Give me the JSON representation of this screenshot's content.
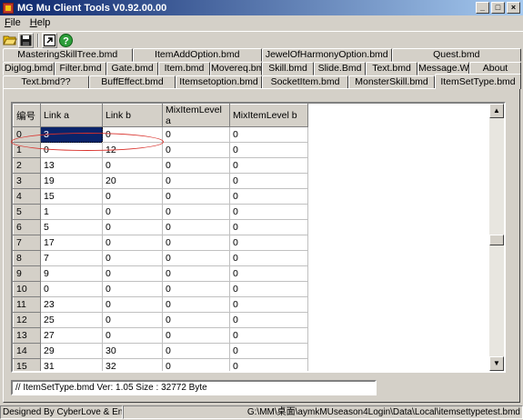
{
  "window": {
    "title": "MG Mu Client Tools  V0.92.00.00",
    "minimize": "_",
    "maximize": "□",
    "close": "×"
  },
  "menu": [
    {
      "underline": "F",
      "rest": "ile"
    },
    {
      "underline": "H",
      "rest": "elp"
    }
  ],
  "toolbar": {
    "icons": [
      "open-folder-icon",
      "save-icon",
      "export-icon",
      "help-icon"
    ]
  },
  "tabs": {
    "row1": [
      "MasteringSkillTree.bmd",
      "ItemAddOption.bmd",
      "JewelOfHarmonyOption.bmd",
      "Quest.bmd"
    ],
    "row2": [
      "Diglog.bmd",
      "Filter.bmd",
      "Gate.bmd",
      "Item.bmd",
      "Movereq.bmd",
      "Skill.bmd",
      "Slide.Bmd",
      "Text.bmd",
      "Message.Wtf",
      "About"
    ],
    "row3": [
      "Text.bmd??",
      "BuffEffect.bmd",
      "Itemsetoption.bmd",
      "SocketItem.bmd",
      "MonsterSkill.bmd",
      "ItemSetType.bmd"
    ],
    "active": "ItemSetType.bmd"
  },
  "grid": {
    "columns": [
      "编号",
      "Link a",
      "Link b",
      "MixItemLevel a",
      "MixItemLevel b"
    ],
    "rows": [
      [
        "0",
        "3",
        "0",
        "0",
        "0"
      ],
      [
        "1",
        "0",
        "12",
        "0",
        "0"
      ],
      [
        "2",
        "13",
        "0",
        "0",
        "0"
      ],
      [
        "3",
        "19",
        "20",
        "0",
        "0"
      ],
      [
        "4",
        "15",
        "0",
        "0",
        "0"
      ],
      [
        "5",
        "1",
        "0",
        "0",
        "0"
      ],
      [
        "6",
        "5",
        "0",
        "0",
        "0"
      ],
      [
        "7",
        "17",
        "0",
        "0",
        "0"
      ],
      [
        "8",
        "7",
        "0",
        "0",
        "0"
      ],
      [
        "9",
        "9",
        "0",
        "0",
        "0"
      ],
      [
        "10",
        "0",
        "0",
        "0",
        "0"
      ],
      [
        "11",
        "23",
        "0",
        "0",
        "0"
      ],
      [
        "12",
        "25",
        "0",
        "0",
        "0"
      ],
      [
        "13",
        "27",
        "0",
        "0",
        "0"
      ],
      [
        "14",
        "29",
        "30",
        "0",
        "0"
      ],
      [
        "15",
        "31",
        "32",
        "0",
        "0"
      ]
    ],
    "selected": {
      "row": 0,
      "col": 1
    },
    "highlight_color": "#d9302a"
  },
  "info": "// ItemSetType.bmd Ver: 1.05 Size : 32772 Byte",
  "status": {
    "left": "Designed By  CyberLove & Endi",
    "right": "G:\\MM\\桌面\\aymkMUseason4Login\\Data\\Local\\itemsettypetest.bmd"
  },
  "colors": {
    "titlebar": "#0a246a",
    "selection": "#0a246a",
    "face": "#d4d0c8"
  }
}
